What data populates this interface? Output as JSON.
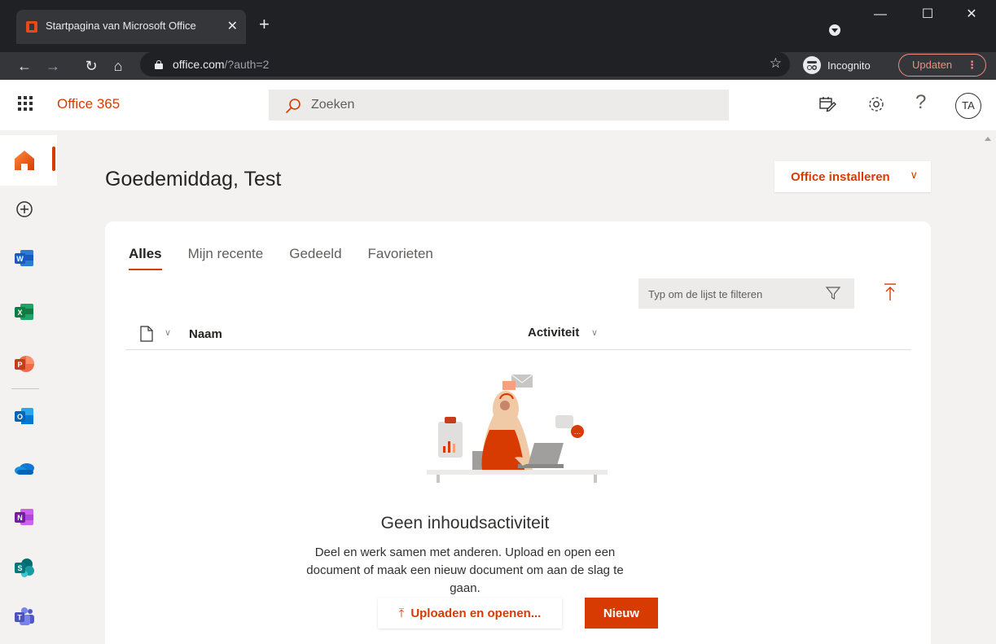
{
  "browser": {
    "tab_title": "Startpagina van Microsoft Office",
    "tab_close": "✕",
    "new_tab": "+",
    "window": {
      "minimize": "—",
      "maximize": "☐",
      "close": "✕"
    },
    "nav": {
      "back": "←",
      "forward": "→",
      "reload": "↻",
      "home": "⌂"
    },
    "url_host": "office.com",
    "url_path": "/?auth=2",
    "star": "☆",
    "incognito_label": "Incognito",
    "update_label": "Updaten",
    "update_kebab": "⋮"
  },
  "header": {
    "brand": "Office 365",
    "search_placeholder": "Zoeken",
    "help": "?",
    "avatar_initials": "TA"
  },
  "rail": {
    "items": [
      "home-icon",
      "create-icon",
      "word-icon",
      "excel-icon",
      "powerpoint-icon",
      "outlook-icon",
      "onedrive-icon",
      "onenote-icon",
      "sharepoint-icon",
      "teams-icon"
    ]
  },
  "main": {
    "greeting": "Goedemiddag, Test",
    "install_label": "Office installeren",
    "install_chev": "∨",
    "tabs": [
      {
        "label": "Alles",
        "active": true
      },
      {
        "label": "Mijn recente",
        "active": false
      },
      {
        "label": "Gedeeld",
        "active": false
      },
      {
        "label": "Favorieten",
        "active": false
      }
    ],
    "filter_placeholder": "Typ om de lijst te filteren",
    "columns": {
      "name": "Naam",
      "activity": "Activiteit",
      "chev": "∨"
    },
    "empty_title": "Geen inhoudsactiviteit",
    "empty_desc": "Deel en werk samen met anderen. Upload en open een document of maak een nieuw document om aan de slag te gaan.",
    "upload_arrow": "⤒",
    "upload_label": "Uploaden en openen...",
    "new_label": "Nieuw"
  },
  "colors": {
    "accent": "#d83b01",
    "chrome_dark": "#202124",
    "chrome_toolbar": "#35363a",
    "page_bg": "#f3f2f1"
  }
}
